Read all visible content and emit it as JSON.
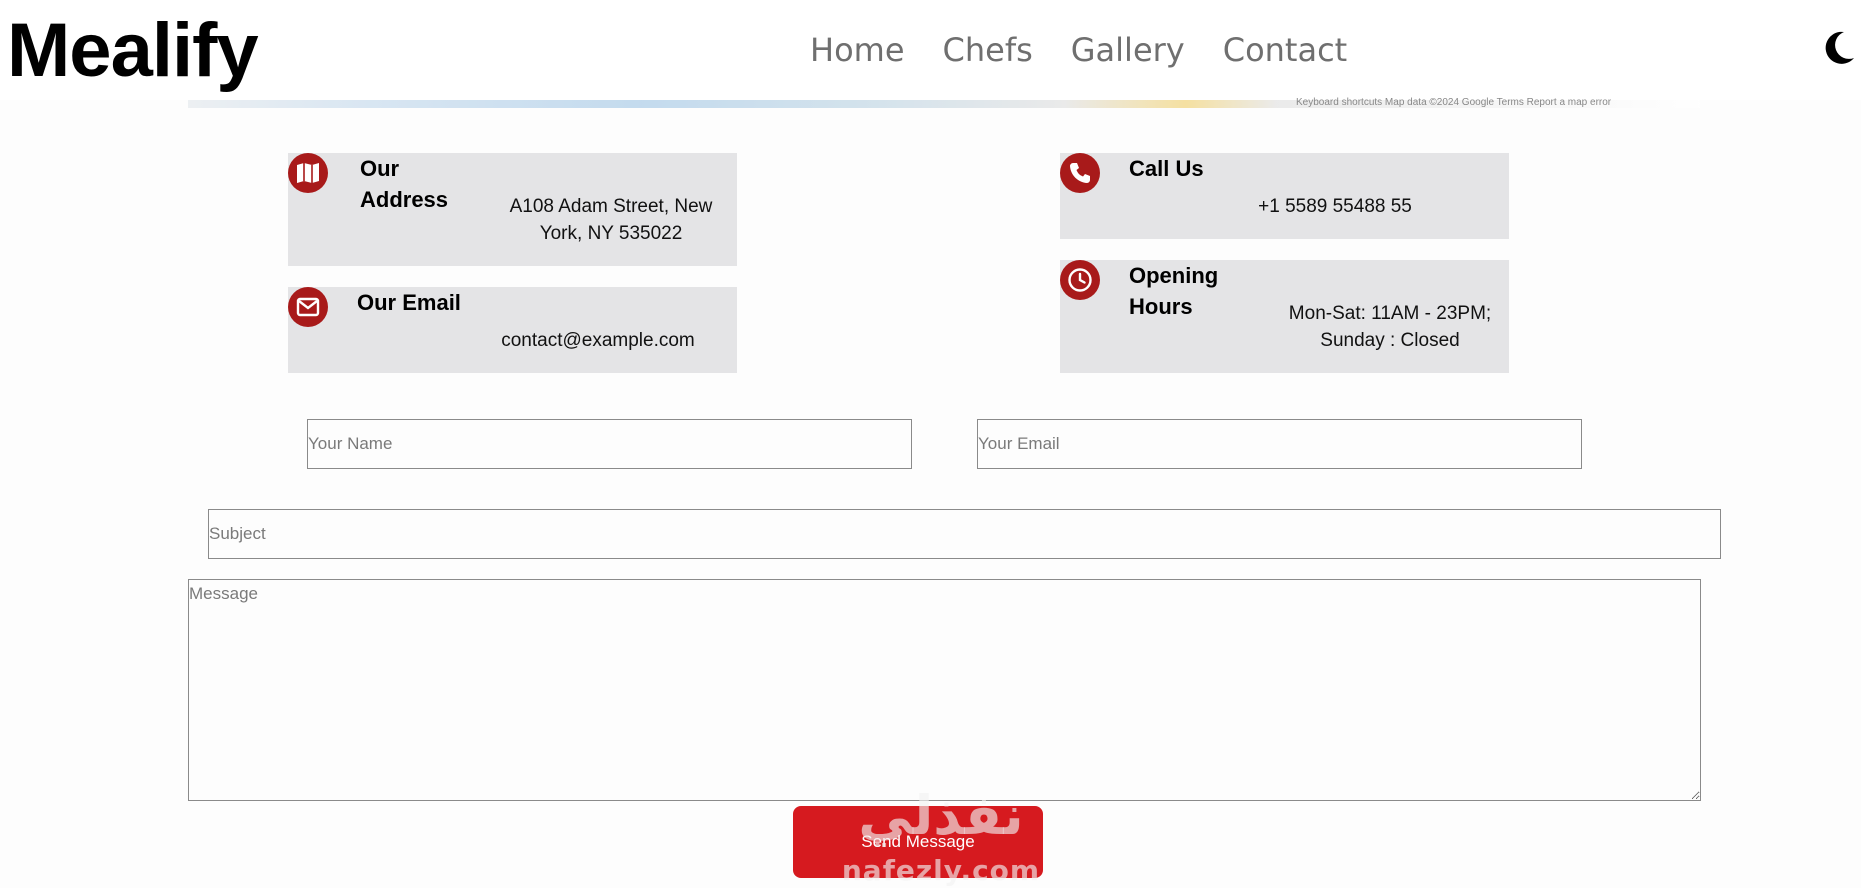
{
  "header": {
    "logo": "Mealify",
    "nav": [
      "Home",
      "Chefs",
      "Gallery",
      "Contact"
    ],
    "theme_toggle_icon": "moon-icon"
  },
  "map": {
    "credits": "Keyboard shortcuts   Map data ©2024 Google   Terms   Report a map error"
  },
  "info": {
    "address": {
      "title": "Our Address",
      "title_line1": "Our",
      "title_line2": "Address",
      "line1": "A108 Adam Street, New",
      "line2": "York, NY 535022",
      "icon": "map-icon"
    },
    "email": {
      "title": "Our Email",
      "value": "contact@example.com",
      "icon": "envelope-icon"
    },
    "call": {
      "title": "Call Us",
      "value": "+1 5589 55488 55",
      "icon": "phone-icon"
    },
    "hours": {
      "title_line1": "Opening",
      "title_line2": "Hours",
      "line1": "Mon-Sat: 11AM - 23PM;",
      "line2": "Sunday : Closed",
      "icon": "clock-icon"
    }
  },
  "form": {
    "name_placeholder": "Your Name",
    "email_placeholder": "Your Email",
    "subject_placeholder": "Subject",
    "message_placeholder": "Message",
    "name_value": "",
    "email_value": "",
    "subject_value": "",
    "message_value": "",
    "submit_label": "Send Message"
  },
  "watermark": {
    "text_arabic": "نفذلي",
    "text_latin": "nafezly.com"
  },
  "colors": {
    "accent": "#d61a1f",
    "icon_bg": "#a81a1a",
    "info_box_bg": "#e4e4e6",
    "nav_text": "#6f6f6f"
  }
}
